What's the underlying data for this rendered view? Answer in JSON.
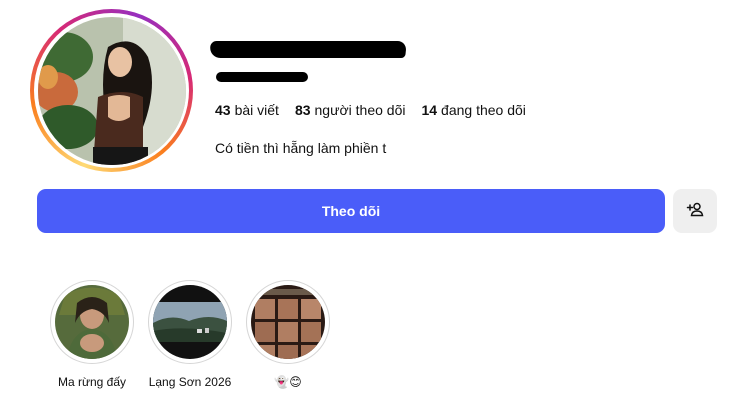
{
  "profile": {
    "bio": "Có tiền thì hẵng làm phiền t"
  },
  "stats": [
    {
      "count": "43",
      "label": "bài viết"
    },
    {
      "count": "83",
      "label": "người theo dõi"
    },
    {
      "count": "14",
      "label": "đang theo dõi"
    }
  ],
  "actions": {
    "follow_label": "Theo dõi"
  },
  "highlights": [
    {
      "label": "Ma rừng đấy"
    },
    {
      "label": "Lạng Sơn 2026"
    },
    {
      "label": "👻😊"
    }
  ],
  "colors": {
    "follow_button": "#4a5df9",
    "secondary_button": "#efefef",
    "redaction": "#000000"
  },
  "icons": {
    "add_user": "person-plus-icon"
  }
}
